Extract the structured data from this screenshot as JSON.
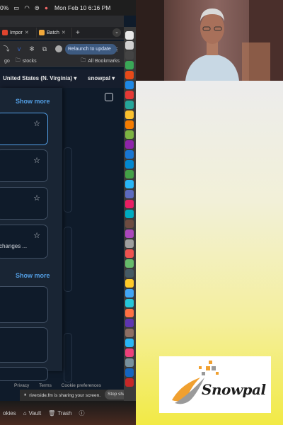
{
  "menubar": {
    "battery": "0%",
    "datetime": "Mon Feb 10  6:16 PM"
  },
  "browser": {
    "tabs": [
      {
        "label": "Impor",
        "color": "#e0442e"
      },
      {
        "label": "Batch",
        "color": "#f2a93b"
      }
    ],
    "relaunch_label": "Relaunch to update",
    "bookmarks": {
      "folder_1": "go",
      "folder_2": "stocks",
      "all_bookmarks": "All Bookmarks"
    }
  },
  "aws": {
    "region": "United States (N. Virginia)",
    "account": "snowpal",
    "panel": {
      "show_more_1": "Show more",
      "show_more_2": "Show more",
      "card_label": "changes ..."
    },
    "footer": {
      "privacy": "Privacy",
      "terms": "Terms",
      "cookie_prefs": "Cookie preferences"
    }
  },
  "sharing": {
    "message": "riverside.fm is sharing your screen.",
    "stop_label": "Stop sharing"
  },
  "bottom_bar": {
    "item_1": "okies",
    "item_2": "Vault",
    "item_3": "Trash"
  },
  "brand": {
    "logo_text": "Snowpal",
    "accent_orange": "#f0a030",
    "accent_gray": "#9a9a9a"
  }
}
